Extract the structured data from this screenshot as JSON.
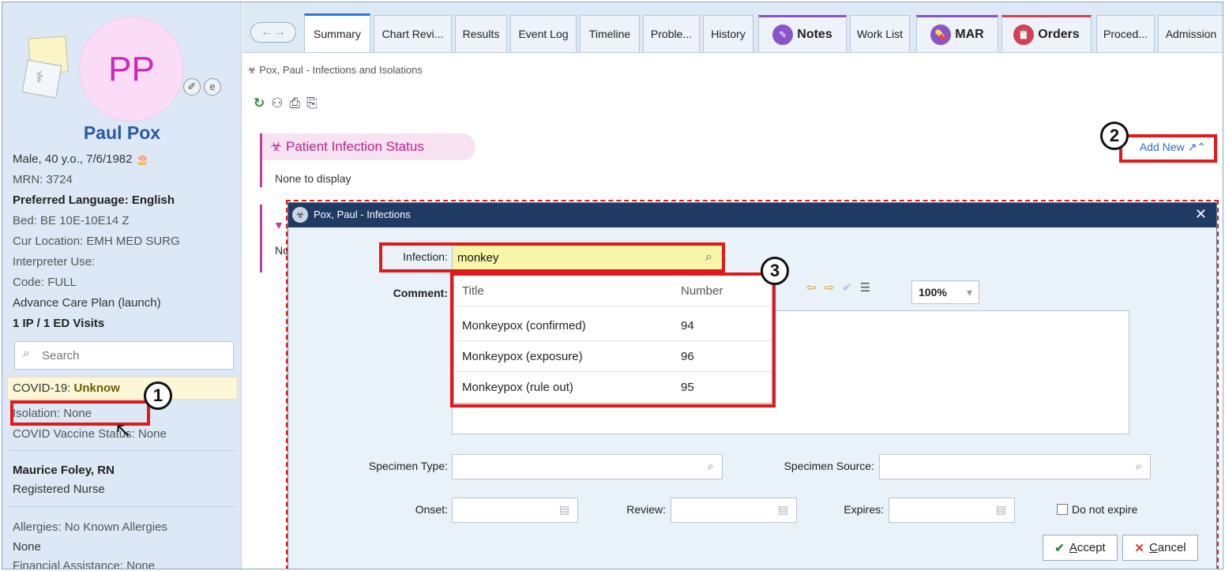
{
  "sidebar": {
    "avatar_initials": "PP",
    "patient_name": "Paul Pox",
    "demographics": "Male, 40 y.o., 7/6/1982",
    "mrn": "MRN: 3724",
    "preferred_language": "Preferred Language: English",
    "bed": "Bed: BE 10E-10E14 Z",
    "cur_location": "Cur Location: EMH MED SURG",
    "interpreter": "Interpreter Use:",
    "code": "Code: FULL",
    "advance_care": "Advance Care Plan (launch)",
    "visits": "1 IP / 1 ED Visits",
    "search_placeholder": "Search",
    "covid_label": "COVID-19: ",
    "covid_value": "Unknow",
    "isolation": "Isolation: None",
    "covid_vaccine": "COVID Vaccine Status: None",
    "nurse_name": "Maurice Foley, RN",
    "nurse_role": "Registered Nurse",
    "allergies": "Allergies: No Known Allergies",
    "allergies_none": "None",
    "financial": "Financial Assistance: None"
  },
  "tabs": [
    {
      "label": "Summary"
    },
    {
      "label": "Chart Revi..."
    },
    {
      "label": "Results"
    },
    {
      "label": "Event Log"
    },
    {
      "label": "Timeline"
    },
    {
      "label": "Proble..."
    },
    {
      "label": "History"
    },
    {
      "label": "Notes"
    },
    {
      "label": "Work List"
    },
    {
      "label": "MAR"
    },
    {
      "label": "Orders"
    },
    {
      "label": "Proced..."
    },
    {
      "label": "Admission"
    }
  ],
  "panel": {
    "title": "Pox, Paul - Infections and Isolations",
    "status_title": "Patient Infection Status",
    "status_empty": "None to display",
    "add_new": "Add New",
    "section2_text": "No"
  },
  "modal": {
    "title": "Pox, Paul - Infections",
    "infection_label": "Infection:",
    "infection_value": "monkey",
    "comment_label": "Comment:",
    "zoom": "100%",
    "dropdown": {
      "headers": {
        "title": "Title",
        "number": "Number"
      },
      "rows": [
        {
          "title": "Monkeypox (confirmed)",
          "number": "94"
        },
        {
          "title": "Monkeypox (exposure)",
          "number": "96"
        },
        {
          "title": "Monkeypox (rule out)",
          "number": "95"
        }
      ]
    },
    "specimen_type_label": "Specimen Type:",
    "specimen_source_label": "Specimen Source:",
    "onset_label": "Onset:",
    "review_label": "Review:",
    "expires_label": "Expires:",
    "do_not_expire": "Do not expire",
    "accept_label": "ccept",
    "accept_key": "A",
    "cancel_label": "ancel",
    "cancel_key": "C"
  },
  "callouts": [
    "1",
    "2",
    "3"
  ],
  "colors": {
    "accent_blue": "#2a78d6",
    "name_blue": "#2a5a9e",
    "infection_pink": "#b9258e",
    "callout_red": "#e01a1a",
    "modal_title_navy": "#1f3a63",
    "infection_field_yellow": "#f8f5a8"
  }
}
